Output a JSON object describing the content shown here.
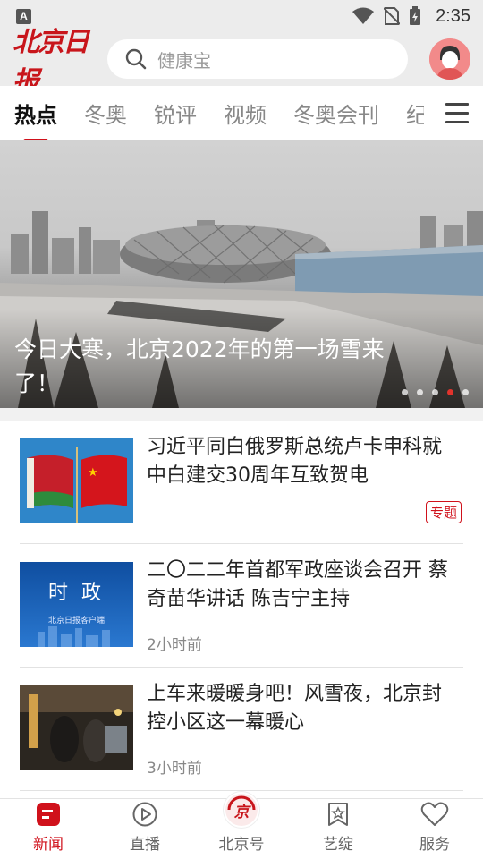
{
  "status_bar": {
    "time": "2:35",
    "indicator": "A"
  },
  "header": {
    "logo_text": "北京日报",
    "search_placeholder": "健康宝",
    "brand_color": "#c8151b"
  },
  "tabs": [
    {
      "label": "热点",
      "active": true
    },
    {
      "label": "冬奥"
    },
    {
      "label": "锐评"
    },
    {
      "label": "视频"
    },
    {
      "label": "冬奥会刊"
    },
    {
      "label": "纪"
    }
  ],
  "banner": {
    "title": "今日大寒，北京2022年的第一场雪来了！",
    "dots_count": 5,
    "active_dot": 4
  },
  "news": [
    {
      "title": "习近平同白俄罗斯总统卢卡申科就中白建交30周年互致贺电",
      "tag": "专题",
      "time": ""
    },
    {
      "title": "二〇二二年首都军政座谈会召开 蔡奇苗华讲话 陈吉宁主持",
      "time": "2小时前",
      "thumb_text": "时  政",
      "thumb_sub": "北京日报客户端"
    },
    {
      "title": "上车来暖暖身吧！风雪夜，北京封控小区这一幕暖心",
      "time": "3小时前"
    }
  ],
  "bottom_nav": [
    {
      "label": "新闻",
      "icon": "news-icon",
      "active": true
    },
    {
      "label": "直播",
      "icon": "play-icon"
    },
    {
      "label": "北京号",
      "icon": "jing-badge-icon",
      "badge_text": "京"
    },
    {
      "label": "艺绽",
      "icon": "star-bookmark-icon"
    },
    {
      "label": "服务",
      "icon": "heart-icon"
    }
  ],
  "colors": {
    "accent": "#d0111b",
    "inactive_tab": "#888888"
  }
}
